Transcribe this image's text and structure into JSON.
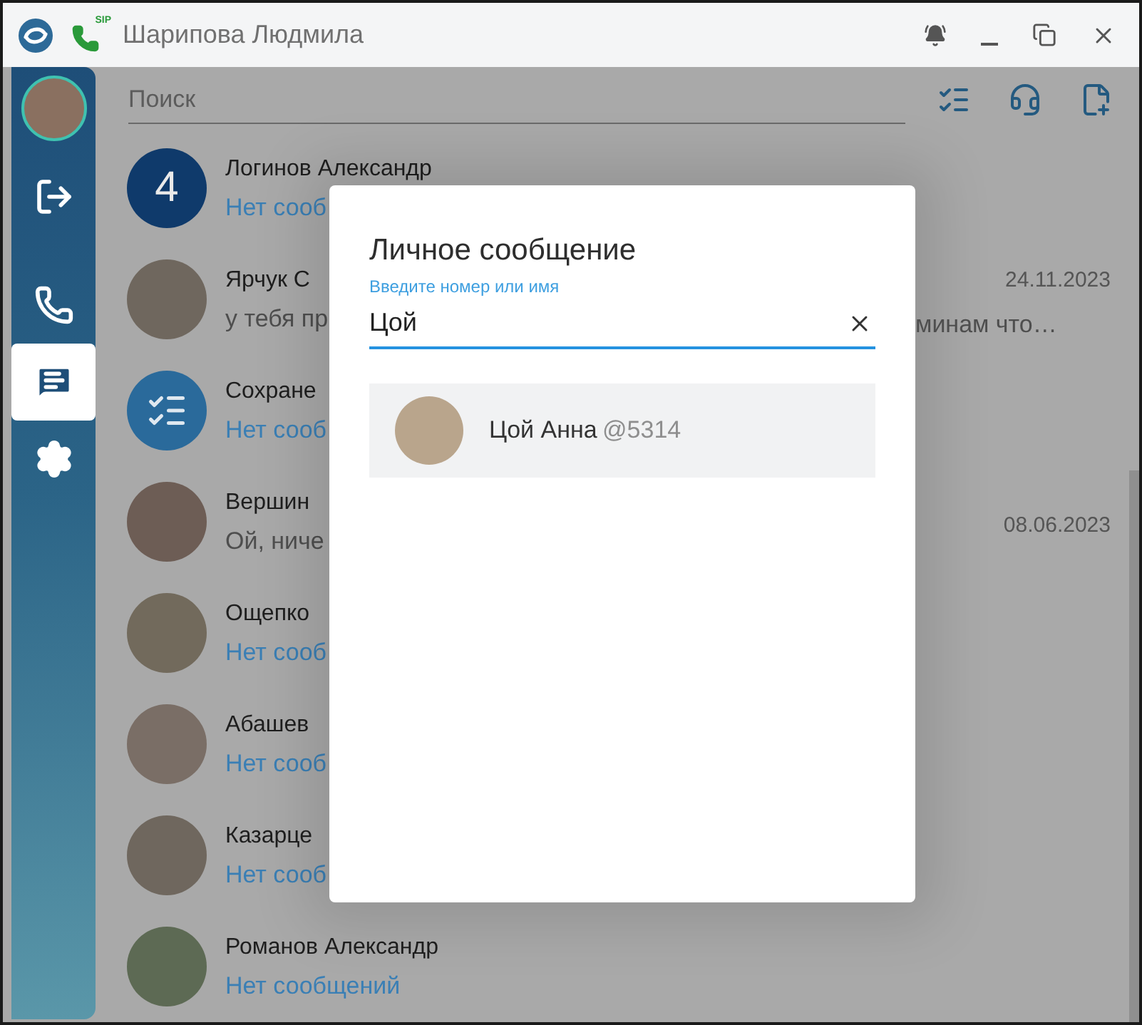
{
  "title_bar": {
    "title": "Шарипова Людмила",
    "sip_label": "SIP"
  },
  "sidebar": {
    "items": [
      {
        "kind": "logout",
        "selected": false
      },
      {
        "kind": "phone",
        "selected": false
      },
      {
        "kind": "chat",
        "selected": true
      },
      {
        "kind": "settings",
        "selected": false
      }
    ]
  },
  "search": {
    "placeholder": "Поиск"
  },
  "chats": [
    {
      "kind": "number",
      "badge": "4",
      "name": "Логинов Александр",
      "preview": "Нет сооб",
      "no_messages": true
    },
    {
      "kind": "photo",
      "name": "Ярчук С",
      "preview": "у тебя пр",
      "preview_tail": "минам что…",
      "date": "24.11.2023",
      "no_messages": false
    },
    {
      "kind": "saved",
      "name": "Сохране",
      "preview": "Нет сооб",
      "no_messages": true
    },
    {
      "kind": "photo",
      "name": "Вершин",
      "preview": "Ой, ниче",
      "date": "08.06.2023",
      "no_messages": false
    },
    {
      "kind": "photo",
      "name": "Ощепко",
      "preview": "Нет сооб",
      "no_messages": true
    },
    {
      "kind": "photo",
      "name": "Абашев",
      "preview": "Нет сооб",
      "no_messages": true
    },
    {
      "kind": "photo",
      "name": "Казарце",
      "preview": "Нет сооб",
      "no_messages": true
    },
    {
      "kind": "photo",
      "name": "Романов Александр",
      "preview": "Нет сообщений",
      "no_messages": true
    }
  ],
  "dialog": {
    "title": "Личное сообщение",
    "label": "Введите номер или имя",
    "value": "Цой",
    "results": [
      {
        "name": "Цой Анна",
        "handle": "@5314",
        "selected": true
      }
    ]
  }
}
